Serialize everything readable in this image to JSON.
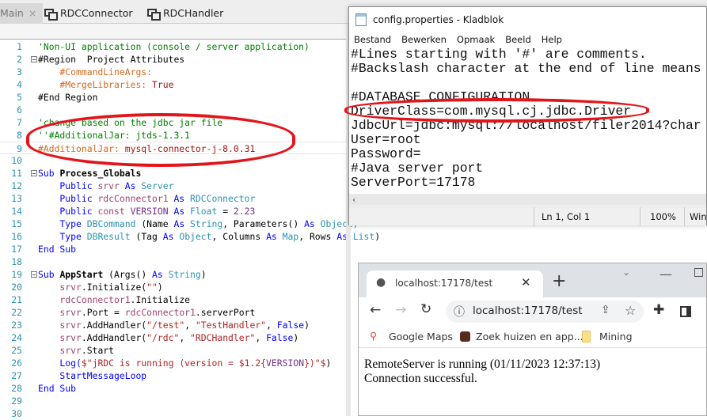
{
  "ide": {
    "tabs": [
      {
        "label": "Main",
        "close": "×"
      },
      {
        "label": "RDCConnector"
      },
      {
        "label": "RDCHandler"
      }
    ],
    "code_lines": [
      [
        [
          "'Non-UI application (console / server application)",
          "cm"
        ]
      ],
      [
        [
          "#Region  Project Attributes",
          "pl"
        ]
      ],
      [
        [
          "    #CommandLineArgs:",
          "at"
        ]
      ],
      [
        [
          "    #MergeLibraries:",
          "at"
        ],
        [
          " True",
          "vl"
        ]
      ],
      [
        [
          "#End Region",
          "pl"
        ]
      ],
      [],
      [
        [
          "'change based on the jdbc jar file",
          "cm"
        ]
      ],
      [
        [
          "''#AdditionalJar: jtds-1.3.1",
          "cm"
        ]
      ],
      [
        [
          "#AdditionalJar:",
          "at"
        ],
        [
          " mysql-connector-j-8.0.31",
          "vl"
        ]
      ],
      [],
      [
        [
          "Sub ",
          "kw"
        ],
        [
          "Process_Globals",
          "pl"
        ]
      ],
      [
        [
          "    Public ",
          "kw"
        ],
        [
          "srvr ",
          "var"
        ],
        [
          "As ",
          "kw"
        ],
        [
          "Server",
          "ty"
        ]
      ],
      [
        [
          "    Public ",
          "kw"
        ],
        [
          "rdcConnector1 ",
          "var"
        ],
        [
          "As ",
          "kw"
        ],
        [
          "RDCConnector",
          "ty"
        ]
      ],
      [
        [
          "    Public ",
          "kw"
        ],
        [
          "const ",
          "var"
        ],
        [
          "VERSION ",
          "pp"
        ],
        [
          "As ",
          "kw"
        ],
        [
          "Float",
          "ty"
        ],
        [
          " = ",
          "pl"
        ],
        [
          "2.23",
          "pp"
        ]
      ],
      [
        [
          "    Type ",
          "kw"
        ],
        [
          "DBCommand ",
          "ty"
        ],
        [
          "(Name ",
          "pl"
        ],
        [
          "As ",
          "kw"
        ],
        [
          "String",
          "ty"
        ],
        [
          ", Parameters() ",
          "pl"
        ],
        [
          "As ",
          "kw"
        ],
        [
          "Object)",
          "ty"
        ]
      ],
      [
        [
          "    Type ",
          "kw"
        ],
        [
          "DBResult ",
          "ty"
        ],
        [
          "(Tag ",
          "pl"
        ],
        [
          "As ",
          "kw"
        ],
        [
          "Object",
          "ty"
        ],
        [
          ", Columns ",
          "pl"
        ],
        [
          "As ",
          "kw"
        ],
        [
          "Map",
          "ty"
        ],
        [
          ", Rows ",
          "pl"
        ],
        [
          "As ",
          "kw"
        ],
        [
          "List",
          "ty"
        ],
        [
          ")",
          "pl"
        ]
      ],
      [
        [
          "End Sub",
          "kw"
        ]
      ],
      [],
      [
        [
          "Sub ",
          "kw"
        ],
        [
          "AppStart ",
          "pl"
        ],
        [
          "(Args() ",
          "pl"
        ],
        [
          "As ",
          "kw"
        ],
        [
          "String",
          "ty"
        ],
        [
          ")",
          "pl"
        ]
      ],
      [
        [
          "    srvr",
          "var"
        ],
        [
          ".Initialize(",
          "pl"
        ],
        [
          "\"\"",
          "st"
        ],
        [
          ")",
          "pl"
        ]
      ],
      [
        [
          "    rdcConnector1",
          "var"
        ],
        [
          ".Initialize",
          "pl"
        ]
      ],
      [
        [
          "    srvr",
          "var"
        ],
        [
          ".Port = ",
          "pl"
        ],
        [
          "rdcConnector1",
          "var"
        ],
        [
          ".serverPort",
          "pl"
        ]
      ],
      [
        [
          "    srvr",
          "var"
        ],
        [
          ".AddHandler(",
          "pl"
        ],
        [
          "\"/test\"",
          "st"
        ],
        [
          ", ",
          "pl"
        ],
        [
          "\"TestHandler\"",
          "st"
        ],
        [
          ", ",
          "pl"
        ],
        [
          "False",
          "kw"
        ],
        [
          ")",
          "pl"
        ]
      ],
      [
        [
          "    srvr",
          "var"
        ],
        [
          ".AddHandler(",
          "pl"
        ],
        [
          "\"/rdc\"",
          "st"
        ],
        [
          ", ",
          "pl"
        ],
        [
          "\"RDCHandler\"",
          "st"
        ],
        [
          ", ",
          "pl"
        ],
        [
          "False",
          "kw"
        ],
        [
          ")",
          "pl"
        ]
      ],
      [
        [
          "    srvr",
          "var"
        ],
        [
          ".Start",
          "pl"
        ]
      ],
      [
        [
          "    Log(",
          "kw"
        ],
        [
          "$\"jRDC is running (version = $1.2{",
          "st"
        ],
        [
          "VERSION",
          "pp"
        ],
        [
          "})\"$",
          "st"
        ],
        [
          ")",
          "pl"
        ]
      ],
      [
        [
          "    StartMessageLoop",
          "kw"
        ]
      ],
      [
        [
          "End Sub",
          "kw"
        ]
      ],
      [],
      []
    ],
    "fold_lines": [
      2,
      11,
      19
    ]
  },
  "notepad": {
    "title": "config.properties - Kladblok",
    "menu": [
      "Bestand",
      "Bewerken",
      "Opmaak",
      "Beeld",
      "Help"
    ],
    "lines": [
      "#Lines starting with '#' are comments.",
      "#Backslash character at the end of line means",
      "",
      "#DATABASE CONFIGURATION",
      "DriverClass=com.mysql.cj.jdbc.Driver",
      "JdbcUrl=jdbc:mysql://localhost/filer2014?char",
      "User=root",
      "Password=",
      "#Java server port",
      "ServerPort=17178"
    ],
    "status": {
      "position": "Ln 1, Col 1",
      "zoom": "100%",
      "encoding": "Win"
    }
  },
  "browser": {
    "tab_title": "localhost:17178/test",
    "url": "localhost:17178/test",
    "bookmarks": [
      "Google Maps",
      "Zoek huizen en app...",
      "Mining"
    ],
    "content": [
      "RemoteServer is running (01/11/2023 12:37:13)",
      "Connection successful."
    ]
  },
  "colors": {
    "cm": "#008000",
    "pl": "#000000",
    "at": "#d2691e",
    "vl": "#a31515",
    "kw": "#0000ff",
    "var": "#a0416e",
    "ty": "#2b91af",
    "pp": "#6f2d86",
    "st": "#b22222",
    "annotation": "#e3151b"
  }
}
